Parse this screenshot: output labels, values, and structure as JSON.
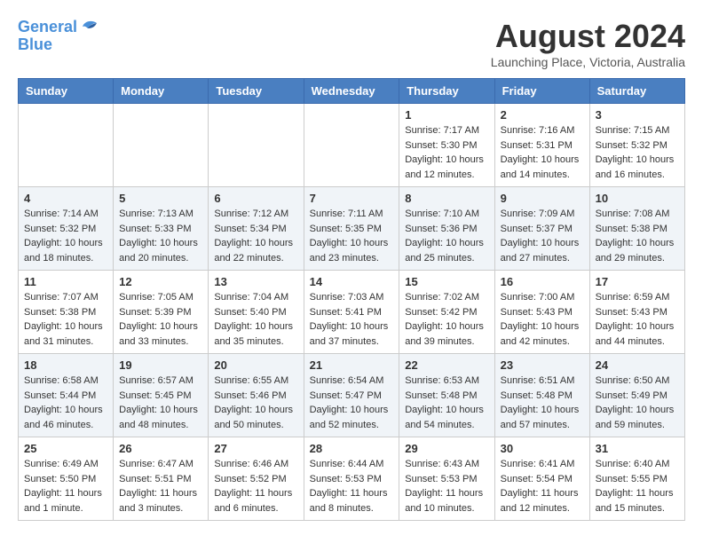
{
  "header": {
    "logo_line1": "General",
    "logo_line2": "Blue",
    "title": "August 2024",
    "subtitle": "Launching Place, Victoria, Australia"
  },
  "weekdays": [
    "Sunday",
    "Monday",
    "Tuesday",
    "Wednesday",
    "Thursday",
    "Friday",
    "Saturday"
  ],
  "weeks": [
    [
      {
        "day": "",
        "info": ""
      },
      {
        "day": "",
        "info": ""
      },
      {
        "day": "",
        "info": ""
      },
      {
        "day": "",
        "info": ""
      },
      {
        "day": "1",
        "info": "Sunrise: 7:17 AM\nSunset: 5:30 PM\nDaylight: 10 hours\nand 12 minutes."
      },
      {
        "day": "2",
        "info": "Sunrise: 7:16 AM\nSunset: 5:31 PM\nDaylight: 10 hours\nand 14 minutes."
      },
      {
        "day": "3",
        "info": "Sunrise: 7:15 AM\nSunset: 5:32 PM\nDaylight: 10 hours\nand 16 minutes."
      }
    ],
    [
      {
        "day": "4",
        "info": "Sunrise: 7:14 AM\nSunset: 5:32 PM\nDaylight: 10 hours\nand 18 minutes."
      },
      {
        "day": "5",
        "info": "Sunrise: 7:13 AM\nSunset: 5:33 PM\nDaylight: 10 hours\nand 20 minutes."
      },
      {
        "day": "6",
        "info": "Sunrise: 7:12 AM\nSunset: 5:34 PM\nDaylight: 10 hours\nand 22 minutes."
      },
      {
        "day": "7",
        "info": "Sunrise: 7:11 AM\nSunset: 5:35 PM\nDaylight: 10 hours\nand 23 minutes."
      },
      {
        "day": "8",
        "info": "Sunrise: 7:10 AM\nSunset: 5:36 PM\nDaylight: 10 hours\nand 25 minutes."
      },
      {
        "day": "9",
        "info": "Sunrise: 7:09 AM\nSunset: 5:37 PM\nDaylight: 10 hours\nand 27 minutes."
      },
      {
        "day": "10",
        "info": "Sunrise: 7:08 AM\nSunset: 5:38 PM\nDaylight: 10 hours\nand 29 minutes."
      }
    ],
    [
      {
        "day": "11",
        "info": "Sunrise: 7:07 AM\nSunset: 5:38 PM\nDaylight: 10 hours\nand 31 minutes."
      },
      {
        "day": "12",
        "info": "Sunrise: 7:05 AM\nSunset: 5:39 PM\nDaylight: 10 hours\nand 33 minutes."
      },
      {
        "day": "13",
        "info": "Sunrise: 7:04 AM\nSunset: 5:40 PM\nDaylight: 10 hours\nand 35 minutes."
      },
      {
        "day": "14",
        "info": "Sunrise: 7:03 AM\nSunset: 5:41 PM\nDaylight: 10 hours\nand 37 minutes."
      },
      {
        "day": "15",
        "info": "Sunrise: 7:02 AM\nSunset: 5:42 PM\nDaylight: 10 hours\nand 39 minutes."
      },
      {
        "day": "16",
        "info": "Sunrise: 7:00 AM\nSunset: 5:43 PM\nDaylight: 10 hours\nand 42 minutes."
      },
      {
        "day": "17",
        "info": "Sunrise: 6:59 AM\nSunset: 5:43 PM\nDaylight: 10 hours\nand 44 minutes."
      }
    ],
    [
      {
        "day": "18",
        "info": "Sunrise: 6:58 AM\nSunset: 5:44 PM\nDaylight: 10 hours\nand 46 minutes."
      },
      {
        "day": "19",
        "info": "Sunrise: 6:57 AM\nSunset: 5:45 PM\nDaylight: 10 hours\nand 48 minutes."
      },
      {
        "day": "20",
        "info": "Sunrise: 6:55 AM\nSunset: 5:46 PM\nDaylight: 10 hours\nand 50 minutes."
      },
      {
        "day": "21",
        "info": "Sunrise: 6:54 AM\nSunset: 5:47 PM\nDaylight: 10 hours\nand 52 minutes."
      },
      {
        "day": "22",
        "info": "Sunrise: 6:53 AM\nSunset: 5:48 PM\nDaylight: 10 hours\nand 54 minutes."
      },
      {
        "day": "23",
        "info": "Sunrise: 6:51 AM\nSunset: 5:48 PM\nDaylight: 10 hours\nand 57 minutes."
      },
      {
        "day": "24",
        "info": "Sunrise: 6:50 AM\nSunset: 5:49 PM\nDaylight: 10 hours\nand 59 minutes."
      }
    ],
    [
      {
        "day": "25",
        "info": "Sunrise: 6:49 AM\nSunset: 5:50 PM\nDaylight: 11 hours\nand 1 minute."
      },
      {
        "day": "26",
        "info": "Sunrise: 6:47 AM\nSunset: 5:51 PM\nDaylight: 11 hours\nand 3 minutes."
      },
      {
        "day": "27",
        "info": "Sunrise: 6:46 AM\nSunset: 5:52 PM\nDaylight: 11 hours\nand 6 minutes."
      },
      {
        "day": "28",
        "info": "Sunrise: 6:44 AM\nSunset: 5:53 PM\nDaylight: 11 hours\nand 8 minutes."
      },
      {
        "day": "29",
        "info": "Sunrise: 6:43 AM\nSunset: 5:53 PM\nDaylight: 11 hours\nand 10 minutes."
      },
      {
        "day": "30",
        "info": "Sunrise: 6:41 AM\nSunset: 5:54 PM\nDaylight: 11 hours\nand 12 minutes."
      },
      {
        "day": "31",
        "info": "Sunrise: 6:40 AM\nSunset: 5:55 PM\nDaylight: 11 hours\nand 15 minutes."
      }
    ]
  ]
}
